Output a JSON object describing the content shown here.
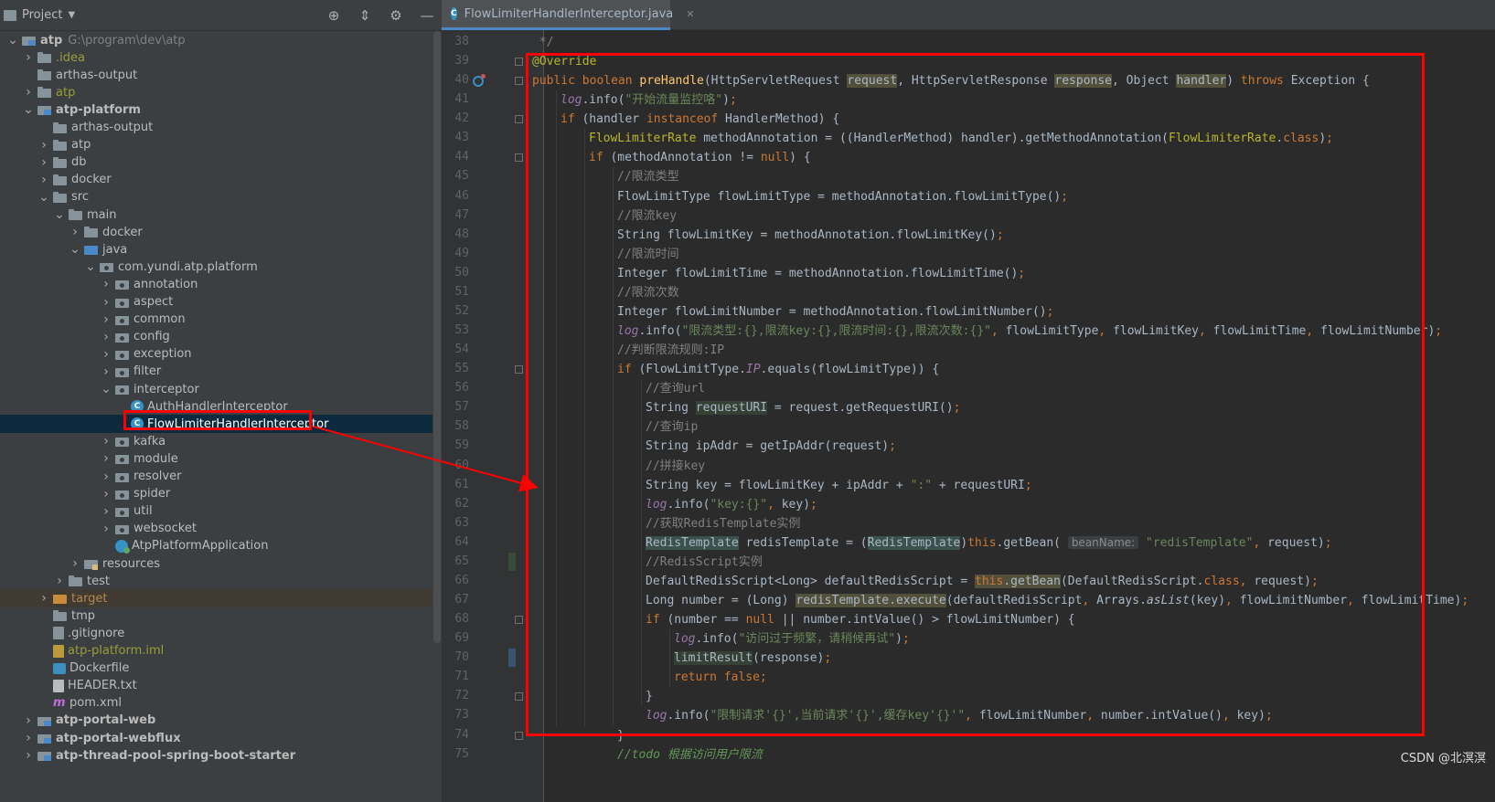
{
  "project_panel": {
    "title": "Project",
    "tree": [
      {
        "indent": 0,
        "arrow": "v",
        "icon": "module",
        "label": "atp",
        "bold": true,
        "hint": "G:\\program\\dev\\atp"
      },
      {
        "indent": 1,
        "arrow": ">",
        "icon": "folder",
        "label": ".idea",
        "cls": "olive"
      },
      {
        "indent": 1,
        "arrow": "",
        "icon": "folder",
        "label": "arthas-output"
      },
      {
        "indent": 1,
        "arrow": ">",
        "icon": "folder",
        "label": "atp",
        "cls": "olive"
      },
      {
        "indent": 1,
        "arrow": "v",
        "icon": "module",
        "label": "atp-platform",
        "bold": true
      },
      {
        "indent": 2,
        "arrow": "",
        "icon": "folder",
        "label": "arthas-output"
      },
      {
        "indent": 2,
        "arrow": ">",
        "icon": "folder",
        "label": "atp"
      },
      {
        "indent": 2,
        "arrow": ">",
        "icon": "folder",
        "label": "db"
      },
      {
        "indent": 2,
        "arrow": ">",
        "icon": "folder",
        "label": "docker"
      },
      {
        "indent": 2,
        "arrow": "v",
        "icon": "folder",
        "label": "src"
      },
      {
        "indent": 3,
        "arrow": "v",
        "icon": "folder",
        "label": "main"
      },
      {
        "indent": 4,
        "arrow": ">",
        "icon": "folder",
        "label": "docker"
      },
      {
        "indent": 4,
        "arrow": "v",
        "icon": "src",
        "label": "java"
      },
      {
        "indent": 5,
        "arrow": "v",
        "icon": "pkg",
        "label": "com.yundi.atp.platform"
      },
      {
        "indent": 6,
        "arrow": ">",
        "icon": "pkg",
        "label": "annotation"
      },
      {
        "indent": 6,
        "arrow": ">",
        "icon": "pkg",
        "label": "aspect"
      },
      {
        "indent": 6,
        "arrow": ">",
        "icon": "pkg",
        "label": "common"
      },
      {
        "indent": 6,
        "arrow": ">",
        "icon": "pkg",
        "label": "config"
      },
      {
        "indent": 6,
        "arrow": ">",
        "icon": "pkg",
        "label": "exception"
      },
      {
        "indent": 6,
        "arrow": ">",
        "icon": "pkg",
        "label": "filter"
      },
      {
        "indent": 6,
        "arrow": "v",
        "icon": "pkg",
        "label": "interceptor"
      },
      {
        "indent": 7,
        "arrow": "",
        "icon": "class",
        "label": "AuthHandlerInterceptor"
      },
      {
        "indent": 7,
        "arrow": "",
        "icon": "class",
        "label": "FlowLimiterHandlerInterceptor",
        "selected": true
      },
      {
        "indent": 6,
        "arrow": ">",
        "icon": "pkg",
        "label": "kafka"
      },
      {
        "indent": 6,
        "arrow": ">",
        "icon": "pkg",
        "label": "module"
      },
      {
        "indent": 6,
        "arrow": ">",
        "icon": "pkg",
        "label": "resolver"
      },
      {
        "indent": 6,
        "arrow": ">",
        "icon": "pkg",
        "label": "spider"
      },
      {
        "indent": 6,
        "arrow": ">",
        "icon": "pkg",
        "label": "util"
      },
      {
        "indent": 6,
        "arrow": ">",
        "icon": "pkg",
        "label": "websocket"
      },
      {
        "indent": 6,
        "arrow": "",
        "icon": "app",
        "label": "AtpPlatformApplication"
      },
      {
        "indent": 4,
        "arrow": ">",
        "icon": "resfolder",
        "label": "resources"
      },
      {
        "indent": 3,
        "arrow": ">",
        "icon": "folder",
        "label": "test"
      },
      {
        "indent": 2,
        "arrow": ">",
        "icon": "target",
        "label": "target",
        "cls": "orange",
        "target": true
      },
      {
        "indent": 2,
        "arrow": "",
        "icon": "folder",
        "label": "tmp"
      },
      {
        "indent": 2,
        "arrow": "",
        "icon": "git",
        "label": ".gitignore"
      },
      {
        "indent": 2,
        "arrow": "",
        "icon": "iml",
        "label": "atp-platform.iml",
        "cls": "olive"
      },
      {
        "indent": 2,
        "arrow": "",
        "icon": "docker",
        "label": "Dockerfile"
      },
      {
        "indent": 2,
        "arrow": "",
        "icon": "txt",
        "label": "HEADER.txt"
      },
      {
        "indent": 2,
        "arrow": "",
        "icon": "maven",
        "label": "pom.xml"
      },
      {
        "indent": 1,
        "arrow": ">",
        "icon": "module",
        "label": "atp-portal-web",
        "bold": true
      },
      {
        "indent": 1,
        "arrow": ">",
        "icon": "module",
        "label": "atp-portal-webflux",
        "bold": true
      },
      {
        "indent": 1,
        "arrow": ">",
        "icon": "module",
        "label": "atp-thread-pool-spring-boot-starter",
        "bold": true
      }
    ]
  },
  "editor": {
    "tab_label": "FlowLimiterHandlerInterceptor.java",
    "line_start": 38,
    "lines": [
      {
        "indent": 0,
        "html": "<span class=\"cm\"> */</span>"
      },
      {
        "indent": 0,
        "html": "<span class=\"ann\">@Override</span>"
      },
      {
        "indent": 0,
        "html": "<span class=\"kw\">public boolean </span><span class=\"fn\">preHandle</span>(HttpServletRequest <span class=\"warn\">request</span>, HttpServletResponse <span class=\"warn\">response</span>, Object <span class=\"warn\">handler</span>) <span class=\"kw\">throws </span>Exception {"
      },
      {
        "indent": 1,
        "html": "<span class=\"fld it\">log</span>.info(<span class=\"str\">\"开始流量监控咯\"</span>)<span class=\"kw\">;</span>"
      },
      {
        "indent": 1,
        "html": "<span class=\"kw\">if </span>(handler <span class=\"kw\">instanceof </span>HandlerMethod) {"
      },
      {
        "indent": 2,
        "html": "<span class=\"ann\">FlowLimiterRate</span> methodAnnotation = ((HandlerMethod) handler).getMethodAnnotation(<span class=\"ann\">FlowLimiterRate</span>.<span class=\"kw\">class</span>)<span class=\"kw\">;</span>"
      },
      {
        "indent": 2,
        "html": "<span class=\"kw\">if </span>(methodAnnotation != <span class=\"kw\">null</span>) {"
      },
      {
        "indent": 3,
        "html": "<span class=\"cm\">//限流类型</span>"
      },
      {
        "indent": 3,
        "html": "FlowLimitType flowLimitType = methodAnnotation.flowLimitType()<span class=\"kw\">;</span>"
      },
      {
        "indent": 3,
        "html": "<span class=\"cm\">//限流key</span>"
      },
      {
        "indent": 3,
        "html": "String flowLimitKey = methodAnnotation.flowLimitKey()<span class=\"kw\">;</span>"
      },
      {
        "indent": 3,
        "html": "<span class=\"cm\">//限流时间</span>"
      },
      {
        "indent": 3,
        "html": "Integer flowLimitTime = methodAnnotation.flowLimitTime()<span class=\"kw\">;</span>"
      },
      {
        "indent": 3,
        "html": "<span class=\"cm\">//限流次数</span>"
      },
      {
        "indent": 3,
        "html": "Integer flowLimitNumber = methodAnnotation.flowLimitNumber()<span class=\"kw\">;</span>"
      },
      {
        "indent": 3,
        "html": "<span class=\"fld it\">log</span>.info(<span class=\"str\">\"限流类型:{},限流key:{},限流时间:{},限流次数:{}\"</span><span class=\"kw\">, </span>flowLimitType<span class=\"kw\">, </span>flowLimitKey<span class=\"kw\">, </span>flowLimitTime<span class=\"kw\">, </span>flowLimitNumber)<span class=\"kw\">;</span>"
      },
      {
        "indent": 3,
        "html": "<span class=\"cm\">//判断限流规则:IP</span>"
      },
      {
        "indent": 3,
        "html": "<span class=\"kw\">if </span>(FlowLimitType.<span class=\"fld it\">IP</span>.equals(flowLimitType)) {"
      },
      {
        "indent": 4,
        "html": "<span class=\"cm\">//查询url</span>"
      },
      {
        "indent": 4,
        "html": "String <span class=\"hl\">requestURI</span> = request.getRequestURI()<span class=\"kw\">;</span>"
      },
      {
        "indent": 4,
        "html": "<span class=\"cm\">//查询ip</span>"
      },
      {
        "indent": 4,
        "html": "String ipAddr = getIpAddr(request)<span class=\"kw\">;</span>"
      },
      {
        "indent": 4,
        "html": "<span class=\"cm\">//拼接key</span>"
      },
      {
        "indent": 4,
        "html": "String key = flowLimitKey + ipAddr + <span class=\"str\">\":\"</span> + requestURI<span class=\"kw\">;</span>"
      },
      {
        "indent": 4,
        "html": "<span class=\"fld it\">log</span>.info(<span class=\"str\">\"key:{}\"</span><span class=\"kw\">, </span>key)<span class=\"kw\">;</span>"
      },
      {
        "indent": 4,
        "html": "<span class=\"cm\">//获取RedisTemplate实例</span>"
      },
      {
        "indent": 4,
        "html": "<span class=\"hl2\">RedisTemplate</span> redisTemplate = (<span class=\"hl2\">RedisTemplate</span>)<span class=\"kw\">this</span>.getBean( <span class=\"hint-inline\">beanName:</span> <span class=\"str\">\"redisTemplate\"</span><span class=\"kw\">, </span>request)<span class=\"kw\">;</span>"
      },
      {
        "indent": 4,
        "html": "<span class=\"cm\">//RedisScript实例</span>"
      },
      {
        "indent": 4,
        "html": "DefaultRedisScript&lt;Long&gt; defaultRedisScript = <span class=\"warn\"><span class=\"kw\">this</span>.getBean</span>(DefaultRedisScript.<span class=\"kw\">class</span><span class=\"kw\">, </span>request)<span class=\"kw\">;</span>"
      },
      {
        "indent": 4,
        "html": "Long number = (Long) <span class=\"warn\">redisTemplate.execute</span>(defaultRedisScript<span class=\"kw\">, </span>Arrays.<span class=\"it\">asList</span>(key)<span class=\"kw\">, </span>flowLimitNumber<span class=\"kw\">, </span>flowLimitTime)<span class=\"kw\">;</span>"
      },
      {
        "indent": 4,
        "html": "<span class=\"kw\">if </span>(number == <span class=\"kw\">null </span>|| number.intValue() &gt; flowLimitNumber) {"
      },
      {
        "indent": 5,
        "html": "<span class=\"fld it\">log</span>.info(<span class=\"str\">\"访问过于频繁，请稍候再试\"</span>)<span class=\"kw\">;</span>"
      },
      {
        "indent": 5,
        "html": "<span class=\"hl\">limitResult</span>(response)<span class=\"kw\">;</span>"
      },
      {
        "indent": 5,
        "html": "<span class=\"kw\">return false;</span>"
      },
      {
        "indent": 4,
        "html": "}"
      },
      {
        "indent": 4,
        "html": "<span class=\"fld it\">log</span>.info(<span class=\"str\">\"限制请求'{}',当前请求'{}',缓存key'{}'\"</span><span class=\"kw\">, </span>flowLimitNumber<span class=\"kw\">, </span>number.intValue()<span class=\"kw\">, </span>key)<span class=\"kw\">;</span>"
      },
      {
        "indent": 3,
        "html": "}"
      },
      {
        "indent": 3,
        "html": "<span class=\"cmi\">//todo 根据访问用户限流</span>"
      }
    ]
  },
  "watermark": "CSDN @北溟溟",
  "colors": {
    "accent": "#4a88c7",
    "annotation_red": "#ff0000",
    "background": "#2b2b2b",
    "panel": "#3c3f41"
  }
}
